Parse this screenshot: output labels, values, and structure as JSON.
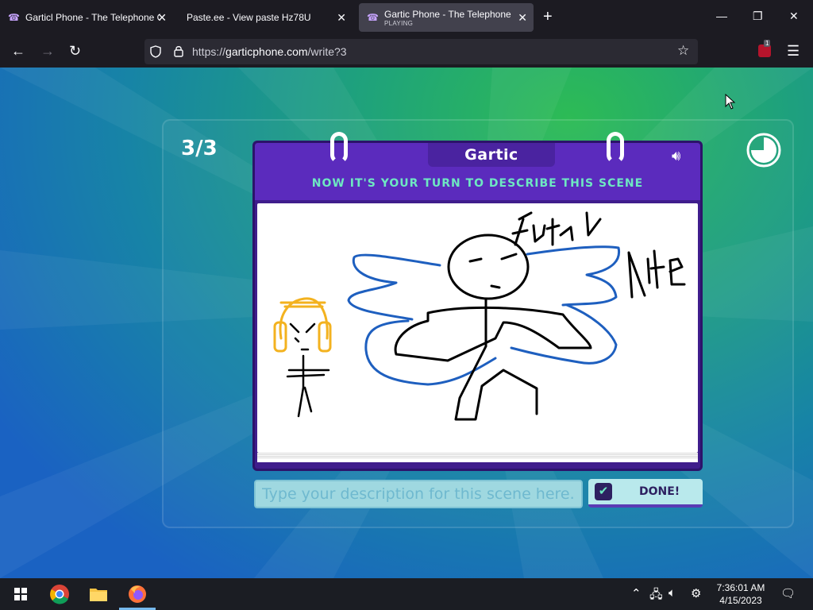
{
  "browser": {
    "tabs": [
      {
        "title": "Garticl Phone - The Telephone G",
        "favicon": "phone-icon",
        "active": false
      },
      {
        "title": "Paste.ee - View paste Hz78U",
        "favicon": "none",
        "active": false
      },
      {
        "title": "Gartic Phone - The Telephone G",
        "subtitle": "PLAYING",
        "favicon": "phone-icon",
        "active": true
      }
    ],
    "url_prefix": "https://",
    "url_host": "garticphone.com",
    "url_path": "/write?3",
    "extension_badge": "1"
  },
  "game": {
    "round": "3/3",
    "logo": "Gartic",
    "instruction": "NOW IT'S YOUR TURN TO DESCRIBE THIS SCENE",
    "input_placeholder": "Type your description for this scene here...",
    "input_value": "",
    "done_label": "DONE!",
    "timer_remaining_fraction": 0.75
  },
  "taskbar": {
    "time": "7:36:01 AM",
    "date": "4/15/2023"
  },
  "colors": {
    "book_purple": "#5b2bbd",
    "accent_teal": "#6ee8c2",
    "drawing_black": "#000000",
    "drawing_blue": "#1e5fbf",
    "drawing_yellow": "#f3b21f"
  }
}
